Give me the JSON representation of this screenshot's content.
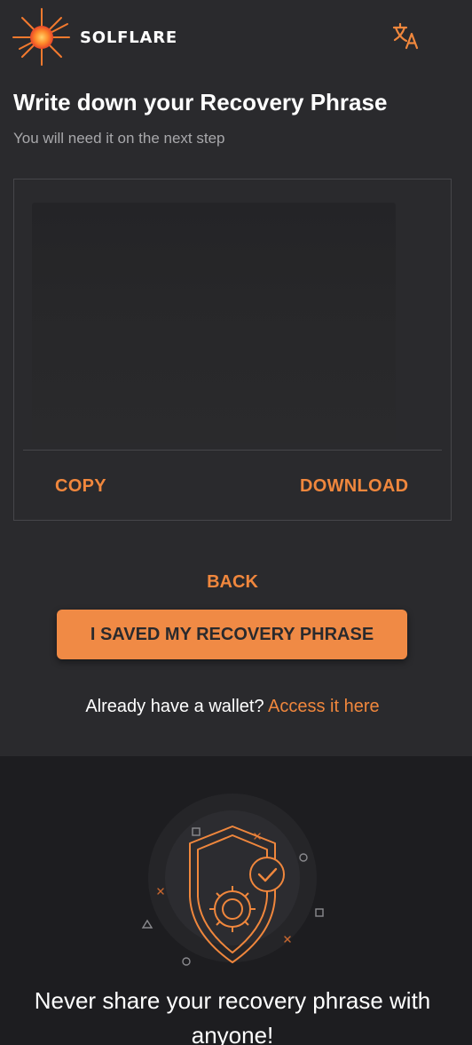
{
  "header": {
    "brand": "SOLFLARE",
    "logo_icon": "sun-flare-icon",
    "language_icon": "translate-icon"
  },
  "main": {
    "title": "Write down your Recovery Phrase",
    "subtitle": "You will need it on the next step",
    "copy_label": "COPY",
    "download_label": "DOWNLOAD",
    "back_label": "BACK",
    "saved_label": "I SAVED MY RECOVERY PHRASE",
    "access_prompt": "Already have a wallet?",
    "access_link": "Access it here"
  },
  "footer": {
    "illustration_icon": "shield-gear-check-icon",
    "warning": "Never share your recovery phrase with anyone!"
  },
  "colors": {
    "background": "#2a2a2d",
    "footer_background": "#1d1d20",
    "accent": "#f0873d",
    "button": "#f08a45",
    "muted_text": "#a8a8ab"
  }
}
